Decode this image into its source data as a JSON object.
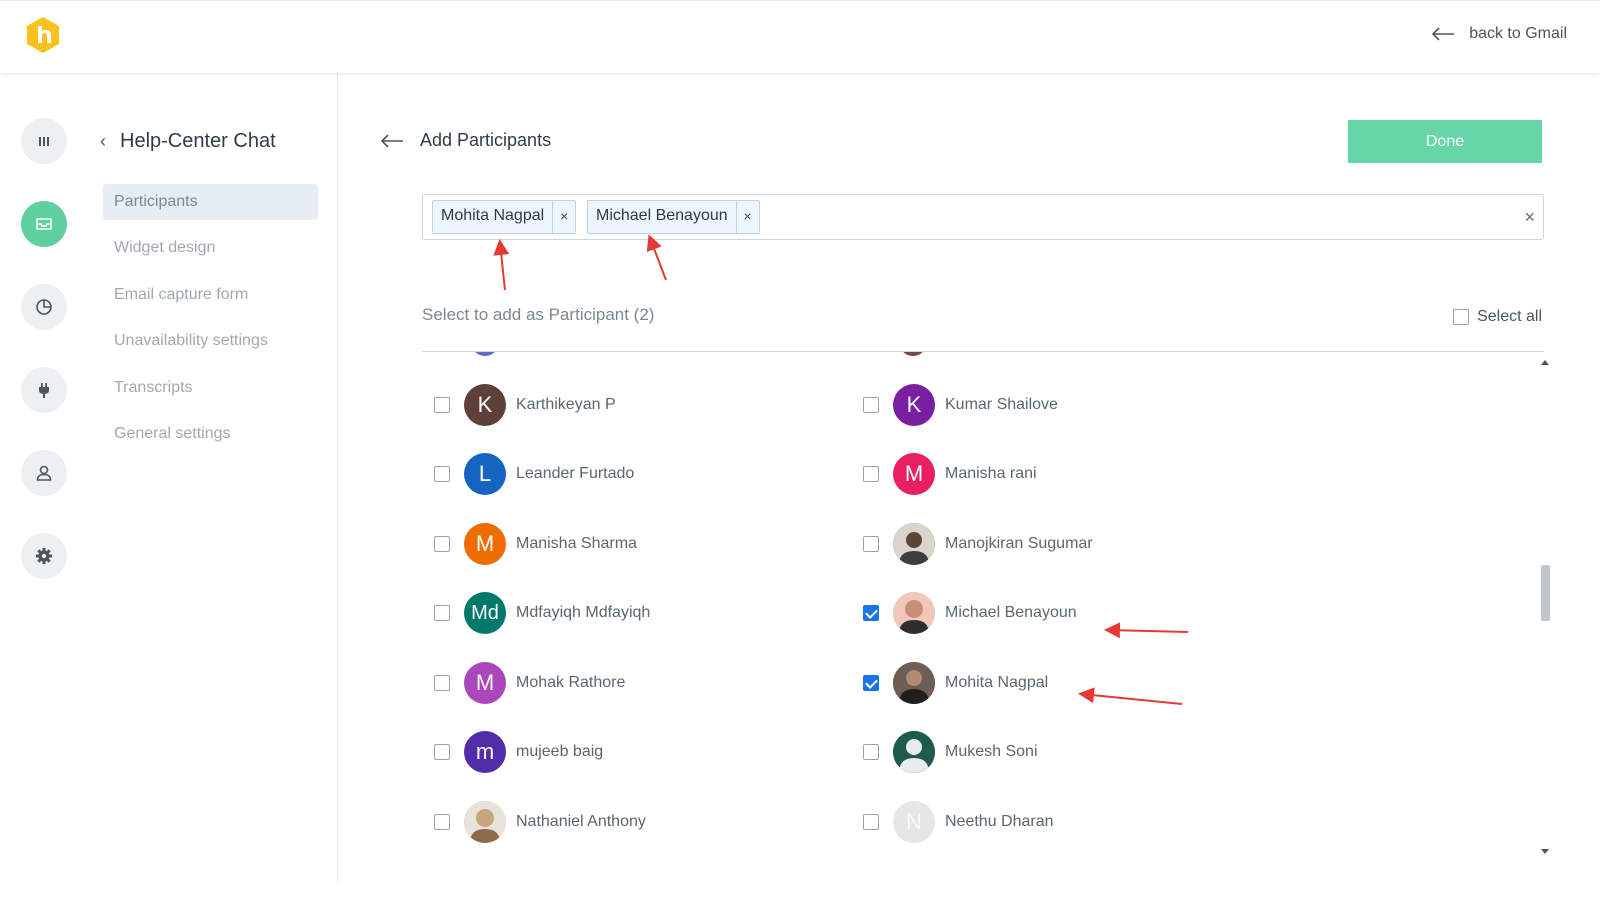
{
  "header": {
    "back_label": "back to Gmail"
  },
  "subnav": {
    "title": "Help-Center Chat",
    "items": [
      {
        "label": "Participants"
      },
      {
        "label": "Widget design"
      },
      {
        "label": "Email capture form"
      },
      {
        "label": "Unavailability settings"
      },
      {
        "label": "Transcripts"
      },
      {
        "label": "General settings"
      }
    ]
  },
  "main": {
    "title": "Add Participants",
    "done_label": "Done",
    "tags": [
      {
        "label": "Mohita Nagpal",
        "remove": "×"
      },
      {
        "label": "Michael Benayoun",
        "remove": "×"
      }
    ],
    "clear": "×",
    "section_label": "Select to add as Participant (2)",
    "select_all_label": "Select all"
  },
  "participants": [
    {
      "name": "Karthikeyan P",
      "initials": "K",
      "color": "#5d4037",
      "checked": false
    },
    {
      "name": "Kumar Shailove",
      "initials": "K",
      "color": "#7b1fa2",
      "checked": false
    },
    {
      "name": "Leander Furtado",
      "initials": "L",
      "color": "#1565c0",
      "checked": false
    },
    {
      "name": "Manisha rani",
      "initials": "M",
      "color": "#e91e63",
      "checked": false
    },
    {
      "name": "Manisha Sharma",
      "initials": "M",
      "color": "#ef6c00",
      "checked": false
    },
    {
      "name": "Manojkiran Sugumar",
      "initials": "",
      "color": "#6d6d6d",
      "checked": false
    },
    {
      "name": "Mdfayiqh Mdfayiqh",
      "initials": "Md",
      "color": "#00796b",
      "checked": false
    },
    {
      "name": "Michael Benayoun",
      "initials": "",
      "color": "#e7b8a8",
      "checked": true
    },
    {
      "name": "Mohak Rathore",
      "initials": "M",
      "color": "#ab47bc",
      "checked": false
    },
    {
      "name": "Mohita Nagpal",
      "initials": "",
      "color": "#5a4a42",
      "checked": true
    },
    {
      "name": "mujeeb baig",
      "initials": "m",
      "color": "#512da8",
      "checked": false
    },
    {
      "name": "Mukesh Soni",
      "initials": "",
      "color": "#1e5a4e",
      "checked": false
    },
    {
      "name": "Nathaniel Anthony",
      "initials": "",
      "color": "#c9a57e",
      "checked": false
    },
    {
      "name": "Neethu Dharan",
      "initials": "N",
      "color": "#e6e6e6",
      "checked": false
    }
  ],
  "colors": {
    "accent": "#5ed0a0",
    "done_button": "#66d6a6",
    "checkbox_checked": "#1a73e8",
    "annotation_arrow": "#e53935"
  },
  "icons": {
    "logo": "hexagon-logo-icon",
    "rail": [
      "bar-chart-icon",
      "inbox-icon",
      "pie-chart-icon",
      "plug-icon",
      "user-icon",
      "gear-icon"
    ]
  }
}
